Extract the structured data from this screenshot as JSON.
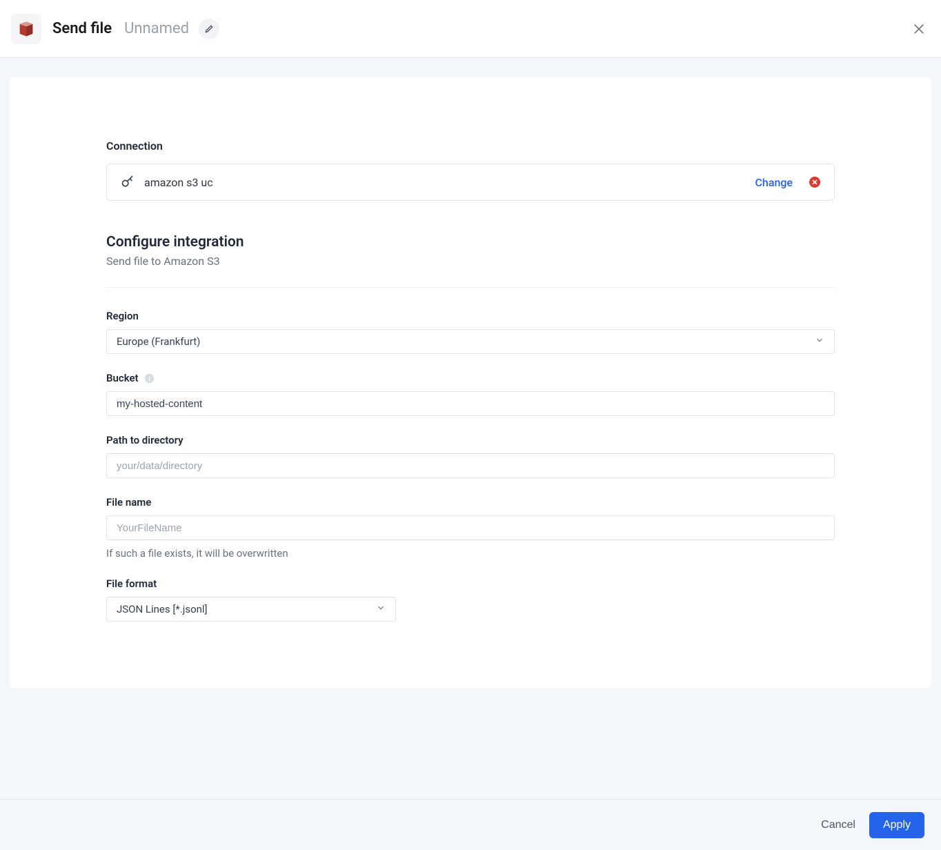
{
  "header": {
    "title": "Send file",
    "subtitle": "Unnamed"
  },
  "connection": {
    "label": "Connection",
    "name": "amazon s3 uc",
    "change_label": "Change"
  },
  "config": {
    "title": "Configure integration",
    "subtitle": "Send file to Amazon S3"
  },
  "fields": {
    "region": {
      "label": "Region",
      "value": "Europe (Frankfurt)"
    },
    "bucket": {
      "label": "Bucket",
      "value": "my-hosted-content"
    },
    "path": {
      "label": "Path to directory",
      "placeholder": "your/data/directory"
    },
    "filename": {
      "label": "File name",
      "placeholder": "YourFileName",
      "helper": "If such a file exists, it will be overwritten"
    },
    "format": {
      "label": "File format",
      "value": "JSON Lines [*.jsonl]"
    }
  },
  "footer": {
    "cancel": "Cancel",
    "apply": "Apply"
  }
}
